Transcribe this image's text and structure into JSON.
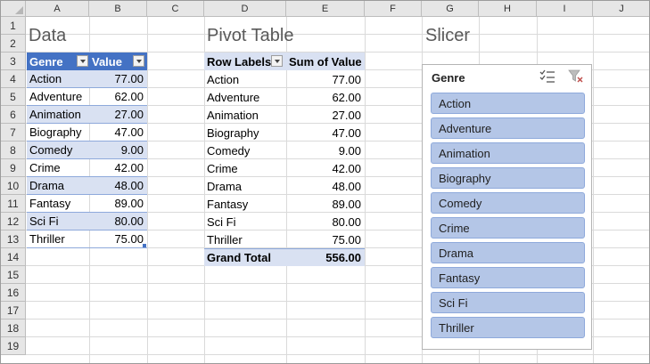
{
  "columns": [
    "A",
    "B",
    "C",
    "D",
    "E",
    "F",
    "G",
    "H",
    "I",
    "J"
  ],
  "rows": [
    "1",
    "2",
    "3",
    "4",
    "5",
    "6",
    "7",
    "8",
    "9",
    "10",
    "11",
    "12",
    "13",
    "14",
    "15",
    "16",
    "17",
    "18",
    "19"
  ],
  "titles": {
    "data": "Data",
    "pivot": "Pivot Table",
    "slicer": "Slicer"
  },
  "table": {
    "headers": [
      "Genre",
      "Value"
    ],
    "rows": [
      [
        "Action",
        "77.00"
      ],
      [
        "Adventure",
        "62.00"
      ],
      [
        "Animation",
        "27.00"
      ],
      [
        "Biography",
        "47.00"
      ],
      [
        "Comedy",
        "9.00"
      ],
      [
        "Crime",
        "42.00"
      ],
      [
        "Drama",
        "48.00"
      ],
      [
        "Fantasy",
        "89.00"
      ],
      [
        "Sci Fi",
        "80.00"
      ],
      [
        "Thriller",
        "75.00"
      ]
    ]
  },
  "pivot": {
    "headers": [
      "Row Labels",
      "Sum of Value"
    ],
    "rows": [
      [
        "Action",
        "77.00"
      ],
      [
        "Adventure",
        "62.00"
      ],
      [
        "Animation",
        "27.00"
      ],
      [
        "Biography",
        "47.00"
      ],
      [
        "Comedy",
        "9.00"
      ],
      [
        "Crime",
        "42.00"
      ],
      [
        "Drama",
        "48.00"
      ],
      [
        "Fantasy",
        "89.00"
      ],
      [
        "Sci Fi",
        "80.00"
      ],
      [
        "Thriller",
        "75.00"
      ]
    ],
    "grand_total_label": "Grand Total",
    "grand_total_value": "556.00"
  },
  "slicer": {
    "header": "Genre",
    "items": [
      "Action",
      "Adventure",
      "Animation",
      "Biography",
      "Comedy",
      "Crime",
      "Drama",
      "Fantasy",
      "Sci Fi",
      "Thriller"
    ],
    "icons": [
      "multi-select-icon",
      "clear-filter-icon"
    ]
  },
  "colors": {
    "table_header": "#4472c4",
    "band": "#d9e1f2",
    "slicer_item": "#b4c6e7"
  }
}
